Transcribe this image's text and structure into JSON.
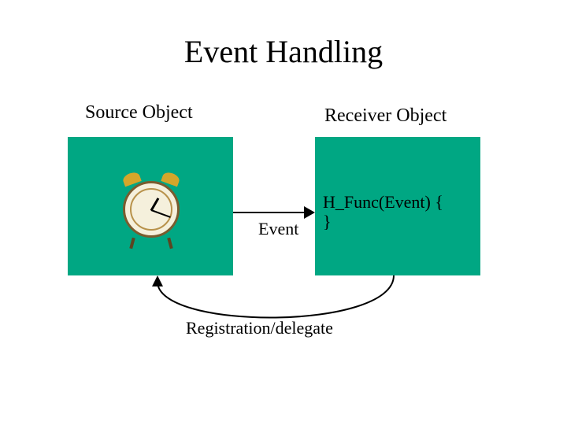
{
  "title": "Event Handling",
  "source": {
    "label": "Source Object",
    "icon": "alarm-clock"
  },
  "receiver": {
    "label": "Receiver Object",
    "code_line1": "H_Func(Event) {",
    "code_line2": "}"
  },
  "arrows": {
    "event_label": "Event",
    "registration_label": "Registration/delegate"
  },
  "colors": {
    "box_fill": "#00a783",
    "arrow": "#000000",
    "background": "#ffffff"
  }
}
